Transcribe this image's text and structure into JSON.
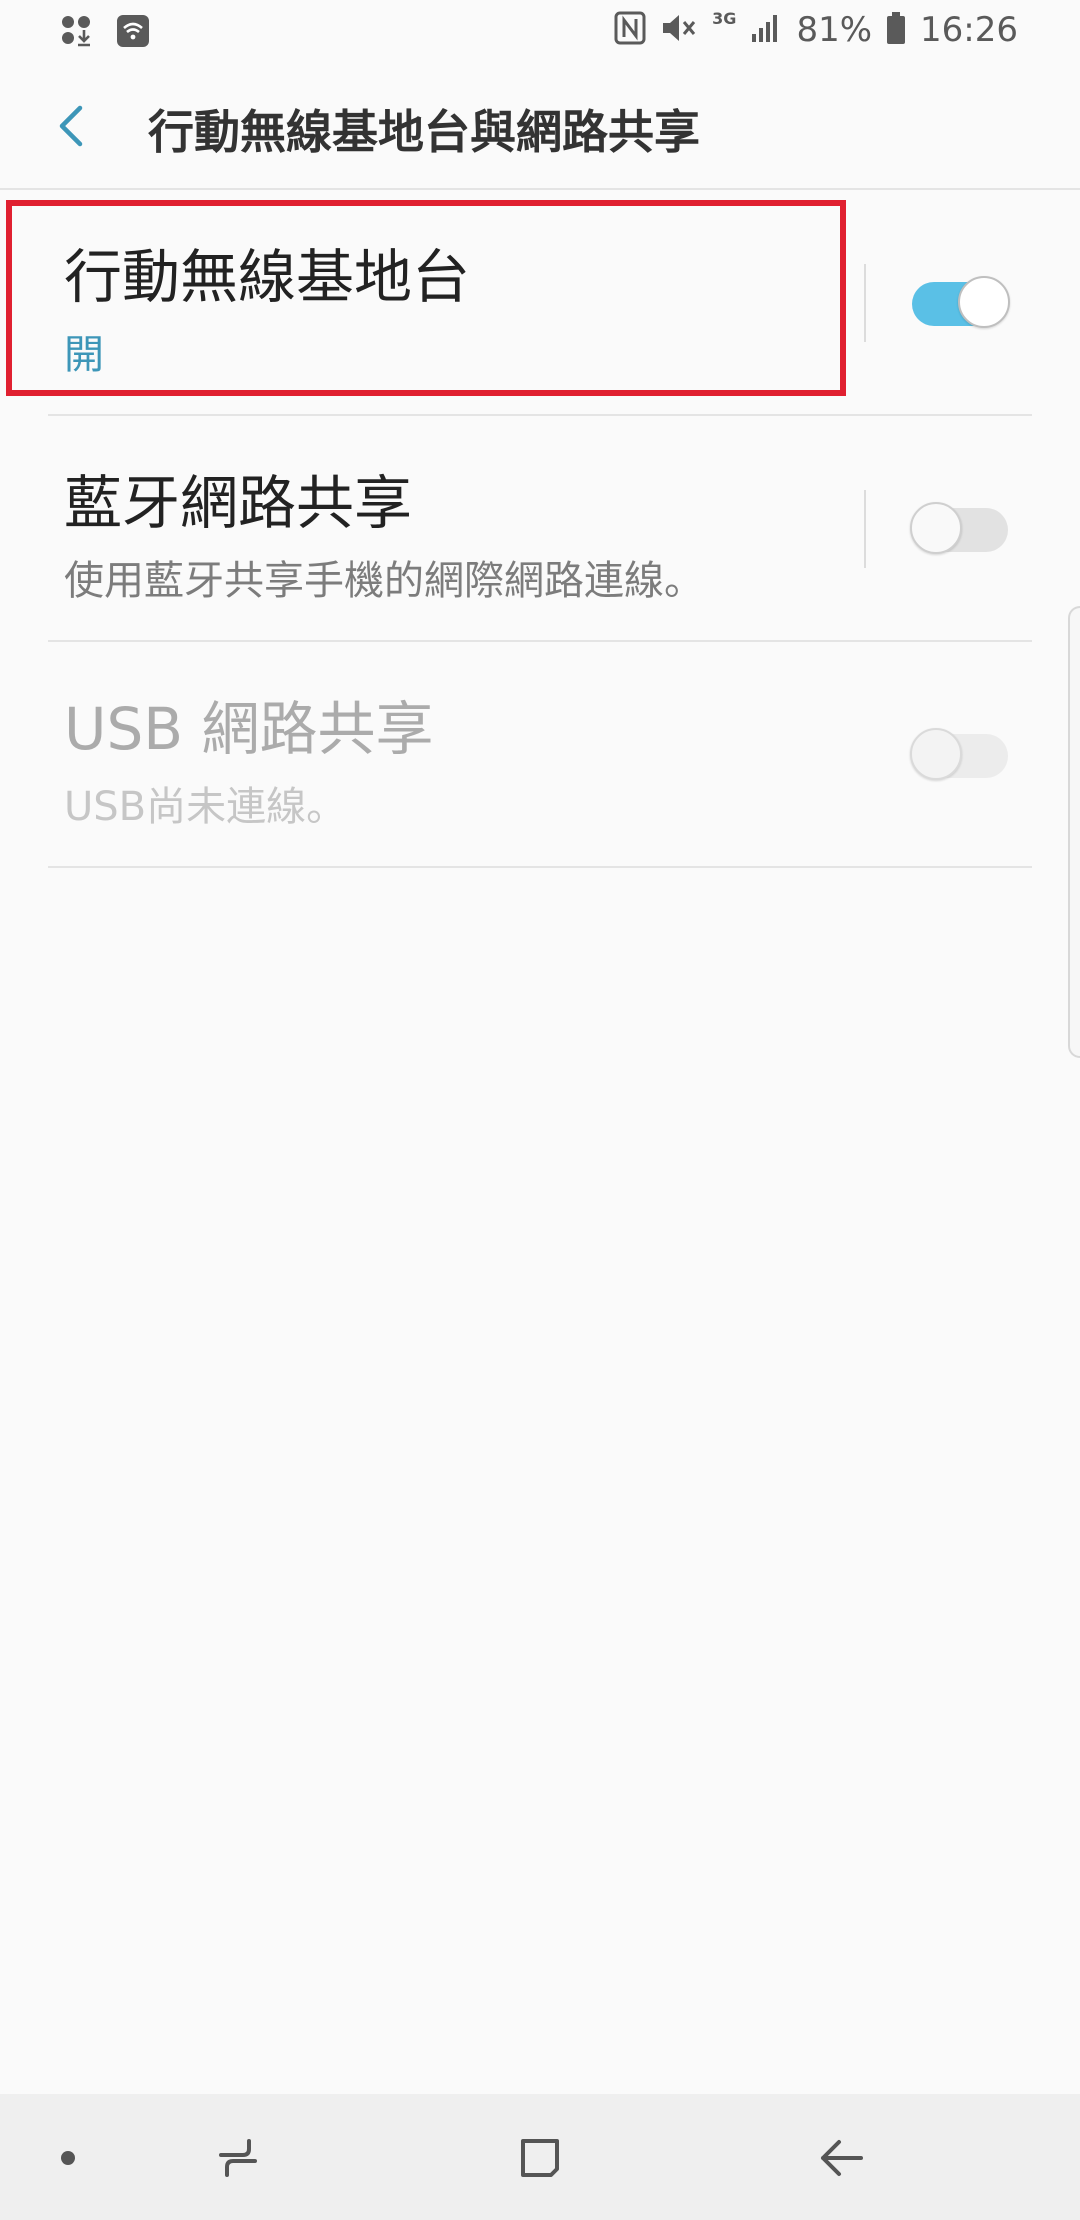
{
  "status_bar": {
    "network_type": "3G",
    "battery_percent": "81%",
    "time": "16:26"
  },
  "app_bar": {
    "title": "行動無線基地台與網路共享"
  },
  "settings": [
    {
      "title": "行動無線基地台",
      "subtitle": "開",
      "toggle_on": true,
      "enabled": true,
      "highlighted": true
    },
    {
      "title": "藍牙網路共享",
      "subtitle": "使用藍牙共享手機的網際網路連線。",
      "toggle_on": false,
      "enabled": true,
      "highlighted": false
    },
    {
      "title": "USB 網路共享",
      "subtitle": "USB尚未連線。",
      "toggle_on": false,
      "enabled": false,
      "highlighted": false
    }
  ],
  "colors": {
    "accent": "#3d96b8",
    "toggle_on": "#5ac0e6",
    "highlight": "#e02030"
  },
  "icons": {
    "status_left": [
      "app-notification-icon",
      "wifi-hotspot-icon"
    ],
    "status_right": [
      "nfc-icon",
      "mute-icon",
      "signal-icon",
      "battery-icon"
    ],
    "nav": [
      "dot-icon",
      "recents-icon",
      "home-icon",
      "back-arrow-icon"
    ]
  }
}
